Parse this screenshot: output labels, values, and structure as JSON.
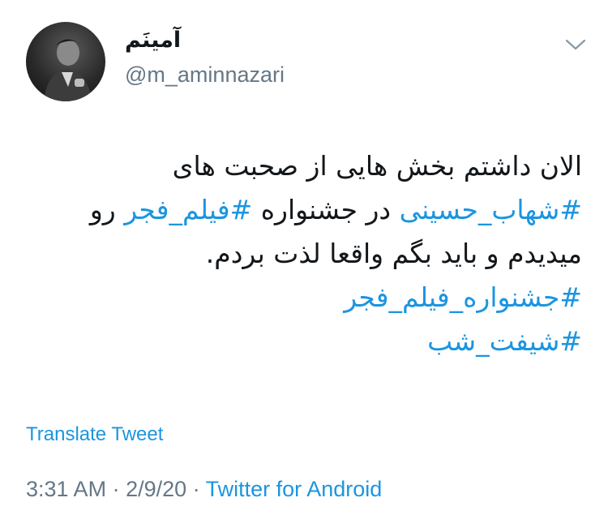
{
  "user": {
    "display_name": "آمینَم",
    "handle": "@m_aminnazari",
    "avatar_icon": "profile-photo"
  },
  "menu": {
    "icon": "chevron-down-icon"
  },
  "tweet": {
    "line1": "الان داشتم بخش هایی از صحبت های",
    "line2_hashtag1": "#شهاب_حسینی",
    "line2_text1": " در جشنواره ",
    "line2_hashtag2": "#فیلم_فجر",
    "line2_text2": " رو",
    "line3": "میدیدم و باید بگم واقعا لذت بردم.",
    "hashtag3": "#جشنواره_فیلم_فجر",
    "hashtag4": "#شیفت_شب"
  },
  "translate_label": "Translate Tweet",
  "meta": {
    "time": "3:31 AM",
    "separator1": " · ",
    "date": "2/9/20",
    "separator2": " · ",
    "source": "Twitter for Android"
  },
  "colors": {
    "link": "#1b95e0",
    "secondary": "#657786",
    "text": "#14171a"
  }
}
